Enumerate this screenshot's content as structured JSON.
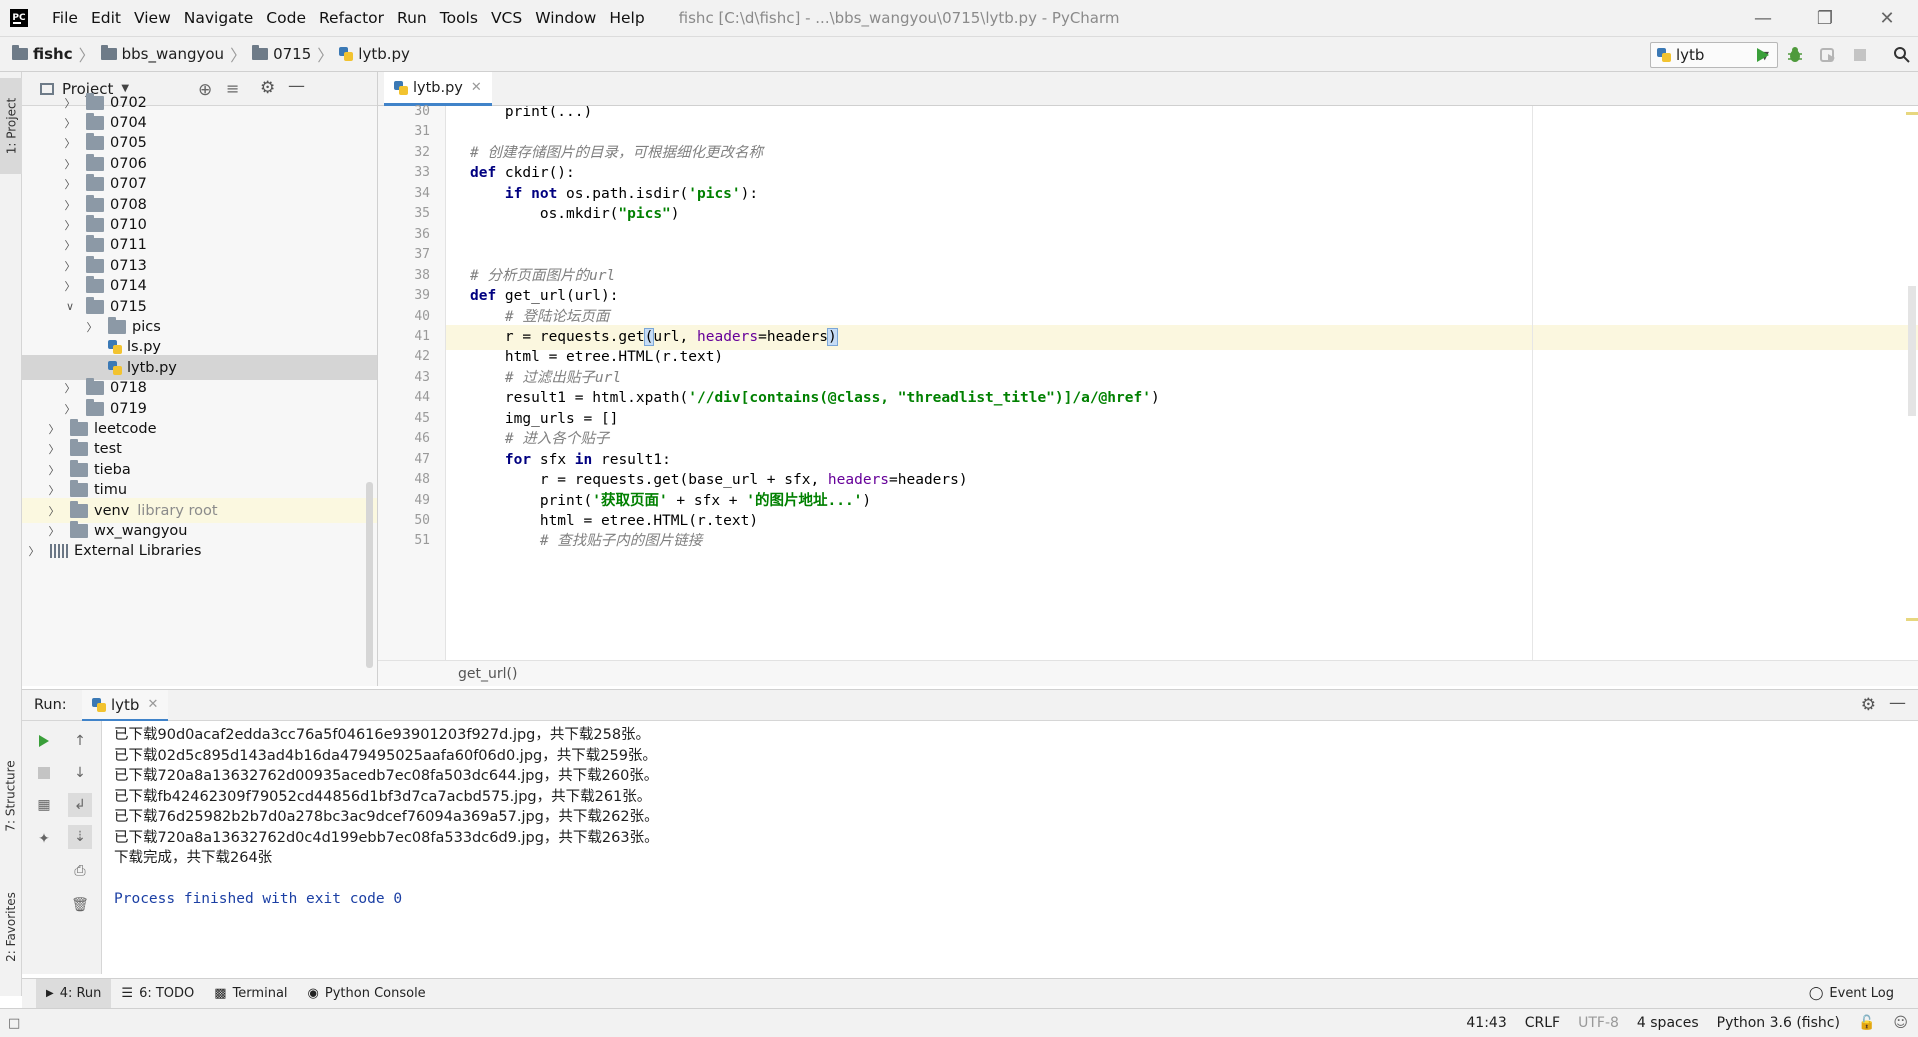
{
  "window": {
    "title": "fishc [C:\\d\\fishc] - ...\\bbs_wangyou\\0715\\lytb.py - PyCharm",
    "menus": [
      "File",
      "Edit",
      "View",
      "Navigate",
      "Code",
      "Refactor",
      "Run",
      "Tools",
      "VCS",
      "Window",
      "Help"
    ]
  },
  "navbar": {
    "breadcrumbs": [
      "fishc",
      "bbs_wangyou",
      "0715",
      "lytb.py"
    ],
    "run_config": "lytb"
  },
  "left_strip": {
    "project_tab": "1: Project",
    "structure_tab": "7: Structure",
    "favorites_tab": "2: Favorites"
  },
  "project": {
    "title": "Project",
    "tree": [
      {
        "label": "0702",
        "type": "folder",
        "depth": 2,
        "expanded": false
      },
      {
        "label": "0704",
        "type": "folder",
        "depth": 2,
        "expanded": false
      },
      {
        "label": "0705",
        "type": "folder",
        "depth": 2,
        "expanded": false
      },
      {
        "label": "0706",
        "type": "folder",
        "depth": 2,
        "expanded": false
      },
      {
        "label": "0707",
        "type": "folder",
        "depth": 2,
        "expanded": false
      },
      {
        "label": "0708",
        "type": "folder",
        "depth": 2,
        "expanded": false
      },
      {
        "label": "0710",
        "type": "folder",
        "depth": 2,
        "expanded": false
      },
      {
        "label": "0711",
        "type": "folder",
        "depth": 2,
        "expanded": false
      },
      {
        "label": "0713",
        "type": "folder",
        "depth": 2,
        "expanded": false
      },
      {
        "label": "0714",
        "type": "folder",
        "depth": 2,
        "expanded": false
      },
      {
        "label": "0715",
        "type": "folder",
        "depth": 2,
        "expanded": true
      },
      {
        "label": "pics",
        "type": "folder",
        "depth": 3,
        "expanded": false
      },
      {
        "label": "ls.py",
        "type": "pyfile",
        "depth": 3
      },
      {
        "label": "lytb.py",
        "type": "pyfile",
        "depth": 3,
        "selected": true
      },
      {
        "label": "0718",
        "type": "folder",
        "depth": 2,
        "expanded": false
      },
      {
        "label": "0719",
        "type": "folder",
        "depth": 2,
        "expanded": false
      },
      {
        "label": "leetcode",
        "type": "folder",
        "depth": 1,
        "expanded": false
      },
      {
        "label": "test",
        "type": "folder",
        "depth": 1,
        "expanded": false
      },
      {
        "label": "tieba",
        "type": "folder",
        "depth": 1,
        "expanded": false
      },
      {
        "label": "timu",
        "type": "folder",
        "depth": 1,
        "expanded": false
      },
      {
        "label": "venv",
        "type": "folder",
        "depth": 1,
        "expanded": false,
        "secondary": "library root"
      },
      {
        "label": "wx_wangyou",
        "type": "folder",
        "depth": 1,
        "expanded": false
      },
      {
        "label": "External Libraries",
        "type": "library",
        "depth": 0,
        "expanded": false
      }
    ]
  },
  "editor": {
    "tab": "lytb.py",
    "current_line": 41,
    "lines": [
      {
        "n": "30",
        "tokens": [
          {
            "t": "p",
            "v": "    print(...)"
          }
        ]
      },
      {
        "n": "31",
        "tokens": []
      },
      {
        "n": "32",
        "tokens": [
          {
            "t": "cm",
            "v": "# 创建存储图片的目录，可根据细化更改名称"
          }
        ]
      },
      {
        "n": "33",
        "tokens": [
          {
            "t": "kw",
            "v": "def"
          },
          {
            "t": "p",
            "v": " ckdir():"
          }
        ]
      },
      {
        "n": "34",
        "tokens": [
          {
            "t": "p",
            "v": "    "
          },
          {
            "t": "kw",
            "v": "if not"
          },
          {
            "t": "p",
            "v": " os.path.isdir("
          },
          {
            "t": "st",
            "v": "'pics'"
          },
          {
            "t": "p",
            "v": "):"
          }
        ]
      },
      {
        "n": "35",
        "tokens": [
          {
            "t": "p",
            "v": "        os.mkdir("
          },
          {
            "t": "st",
            "v": "\"pics\""
          },
          {
            "t": "p",
            "v": ")"
          }
        ]
      },
      {
        "n": "36",
        "tokens": []
      },
      {
        "n": "37",
        "tokens": []
      },
      {
        "n": "38",
        "tokens": [
          {
            "t": "cm",
            "v": "# 分析页面图片的url"
          }
        ]
      },
      {
        "n": "39",
        "tokens": [
          {
            "t": "kw",
            "v": "def"
          },
          {
            "t": "p",
            "v": " get_url(url):"
          }
        ]
      },
      {
        "n": "40",
        "tokens": [
          {
            "t": "cm",
            "v": "    # 登陆论坛页面"
          }
        ]
      },
      {
        "n": "41",
        "tokens": [
          {
            "t": "p",
            "v": "    r = requests.get"
          },
          {
            "t": "br",
            "v": "("
          },
          {
            "t": "p",
            "v": "url, "
          },
          {
            "t": "kwa",
            "v": "headers"
          },
          {
            "t": "p",
            "v": "=headers"
          },
          {
            "t": "br",
            "v": ")"
          }
        ]
      },
      {
        "n": "42",
        "tokens": [
          {
            "t": "p",
            "v": "    html = etree.HTML(r.text)"
          }
        ]
      },
      {
        "n": "43",
        "tokens": [
          {
            "t": "cm",
            "v": "    # 过滤出贴子url"
          }
        ]
      },
      {
        "n": "44",
        "tokens": [
          {
            "t": "p",
            "v": "    result1 = html.xpath("
          },
          {
            "t": "st",
            "v": "'//div[contains(@class, \"threadlist_title\")]/a/@href'"
          },
          {
            "t": "p",
            "v": ")"
          }
        ]
      },
      {
        "n": "45",
        "tokens": [
          {
            "t": "p",
            "v": "    img_urls = []"
          }
        ]
      },
      {
        "n": "46",
        "tokens": [
          {
            "t": "cm",
            "v": "    # 进入各个贴子"
          }
        ]
      },
      {
        "n": "47",
        "tokens": [
          {
            "t": "p",
            "v": "    "
          },
          {
            "t": "kw",
            "v": "for"
          },
          {
            "t": "p",
            "v": " sfx "
          },
          {
            "t": "kw",
            "v": "in"
          },
          {
            "t": "p",
            "v": " result1:"
          }
        ]
      },
      {
        "n": "48",
        "tokens": [
          {
            "t": "p",
            "v": "        r = requests.get(base_url + sfx, "
          },
          {
            "t": "kwa",
            "v": "headers"
          },
          {
            "t": "p",
            "v": "=headers)"
          }
        ]
      },
      {
        "n": "49",
        "tokens": [
          {
            "t": "p",
            "v": "        print("
          },
          {
            "t": "st",
            "v": "'获取页面'"
          },
          {
            "t": "p",
            "v": " + sfx + "
          },
          {
            "t": "st",
            "v": "'的图片地址...'"
          },
          {
            "t": "p",
            "v": ")"
          }
        ]
      },
      {
        "n": "50",
        "tokens": [
          {
            "t": "p",
            "v": "        html = etree.HTML(r.text)"
          }
        ]
      },
      {
        "n": "51",
        "tokens": [
          {
            "t": "cm",
            "v": "        # 查找贴子内的图片链接"
          }
        ]
      }
    ],
    "breadcrumb": "get_url()"
  },
  "run": {
    "label": "Run:",
    "tab": "lytb",
    "output": [
      "已下载90d0acaf2edda3cc76a5f04616e93901203f927d.jpg，共下载258张。",
      "已下载02d5c895d143ad4b16da479495025aafa60f06d0.jpg，共下载259张。",
      "已下载720a8a13632762d00935acedb7ec08fa503dc644.jpg，共下载260张。",
      "已下载fb42462309f79052cd44856d1bf3d7ca7acbd575.jpg，共下载261张。",
      "已下载76d25982b2b7d0a278bc3ac9dcef76094a369a57.jpg，共下载262张。",
      "已下载720a8a13632762d0c4d199ebb7ec08fa533dc6d9.jpg，共下载263张。",
      "下载完成，共下载264张",
      "",
      "Process finished with exit code 0"
    ]
  },
  "tool_tabs": {
    "run": "4: Run",
    "todo": "6: TODO",
    "terminal": "Terminal",
    "python_console": "Python Console",
    "event_log": "Event Log"
  },
  "status": {
    "position": "41:43",
    "line_sep": "CRLF",
    "encoding": "UTF-8",
    "indent": "4 spaces",
    "interpreter": "Python 3.6 (fishc)"
  },
  "colors": {
    "keyword": "#000080",
    "string": "#008000",
    "comment": "#808080",
    "kwarg": "#660099",
    "accent": "#4083c9",
    "run_green": "#3a9f3a"
  }
}
